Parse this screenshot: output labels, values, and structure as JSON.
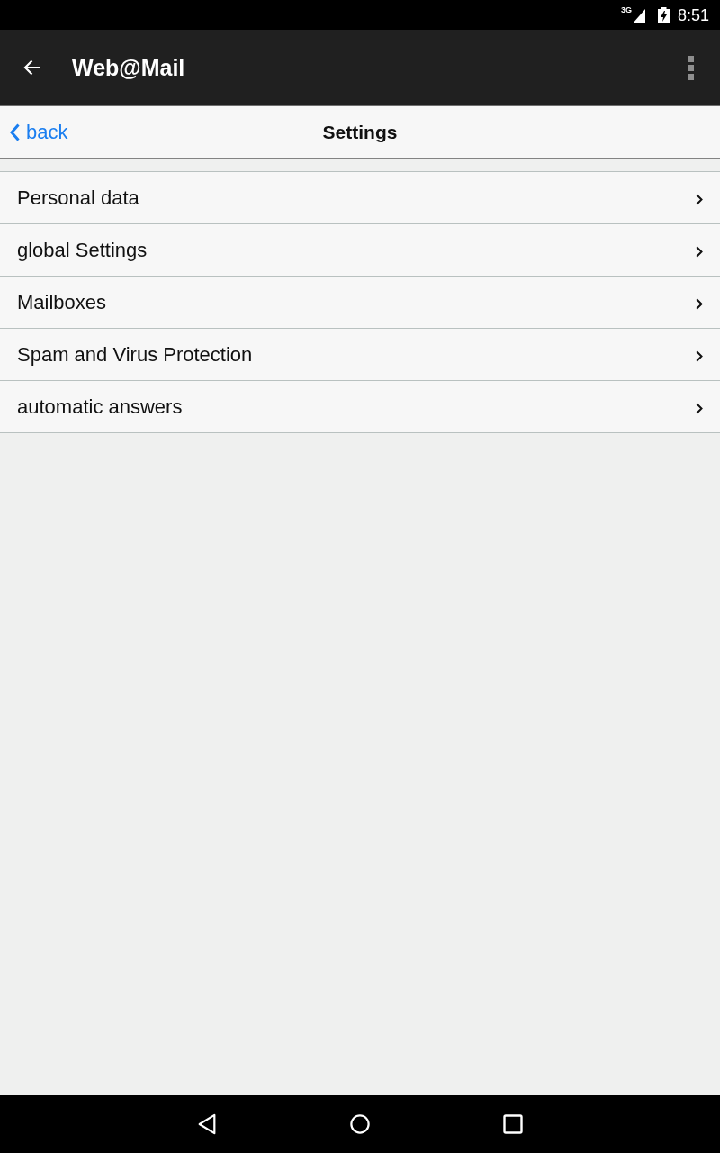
{
  "status_bar": {
    "network": "3G",
    "time": "8:51"
  },
  "app_bar": {
    "title": "Web@Mail"
  },
  "nav_bar": {
    "back": "back",
    "title": "Settings"
  },
  "settings": [
    {
      "label": "Personal data"
    },
    {
      "label": "global Settings"
    },
    {
      "label": "Mailboxes"
    },
    {
      "label": "Spam and Virus Protection"
    },
    {
      "label": "automatic answers"
    }
  ]
}
